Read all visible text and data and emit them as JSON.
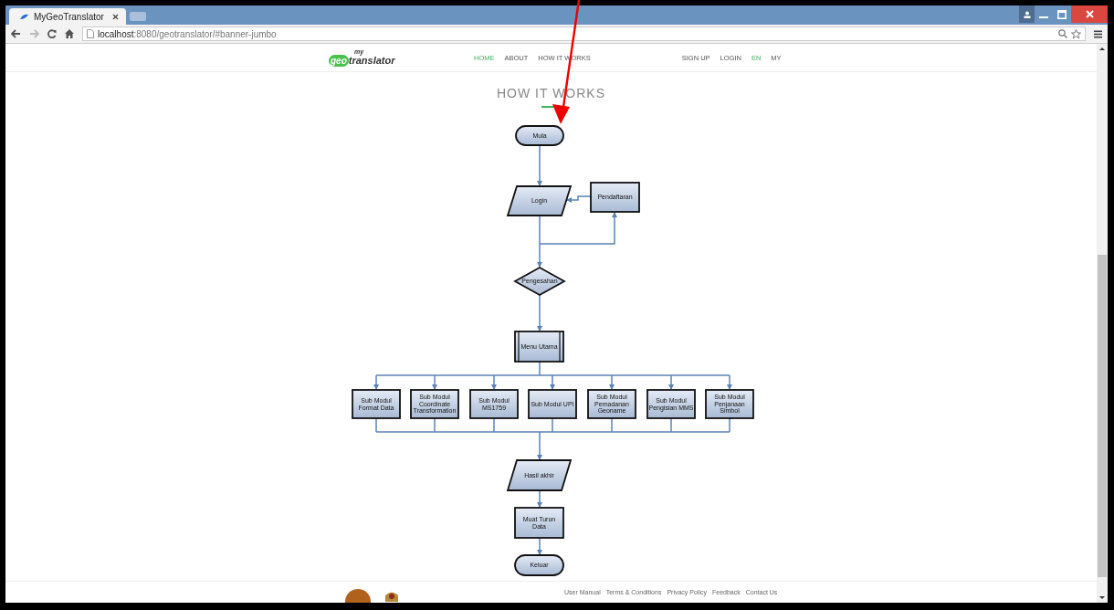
{
  "browser": {
    "tab_title": "MyGeoTranslator",
    "url_host": "localhost",
    "url_path": ":8080/geotranslator/#banner-jumbo"
  },
  "site": {
    "logo_small": "my",
    "logo_geo": "geo",
    "logo_rest": "translator",
    "nav": [
      {
        "label": "HOME",
        "selected": true
      },
      {
        "label": "ABOUT",
        "selected": false
      },
      {
        "label": "HOW IT WORKS",
        "selected": false
      }
    ],
    "nav_right": [
      {
        "label": "SIGN UP",
        "selected": false
      },
      {
        "label": "LOGIN",
        "selected": false
      },
      {
        "label": "EN",
        "selected": true
      },
      {
        "label": "MY",
        "selected": false
      }
    ]
  },
  "section_title": "HOW IT WORKS",
  "flowchart": {
    "nodes": [
      {
        "kind": "terminal",
        "label": "Mula"
      },
      {
        "kind": "io",
        "label": "Login"
      },
      {
        "kind": "process",
        "label": "Pendaftaran"
      },
      {
        "kind": "decision",
        "label": "Pengesahan"
      },
      {
        "kind": "predefined",
        "label": "Menu Utama"
      },
      {
        "kind": "io",
        "label": "Hasil akhir"
      },
      {
        "kind": "process",
        "label": "Muat Turun Data"
      },
      {
        "kind": "terminal",
        "label": "Keluar"
      }
    ],
    "modules": [
      "Sub Modul Format Data",
      "Sub Modul Coordinate Transformation",
      "Sub Modul MS1759",
      "Sub Modul UPI",
      "Sub Modul Pemadanan Geoname",
      "Sub Modul Pengisian MMS",
      "Sub Modul Penjanaan Simbol"
    ]
  },
  "footer_links": [
    "User Manual",
    "Terms & Conditions",
    "Privacy Policy",
    "Feedback",
    "Contact Us"
  ]
}
